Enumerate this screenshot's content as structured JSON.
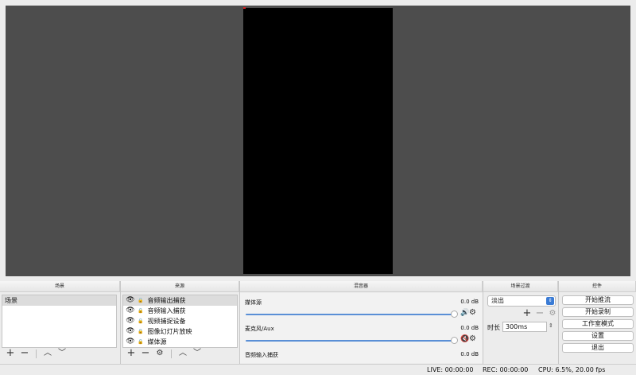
{
  "docks": {
    "scenes": {
      "title": "场景",
      "items": [
        {
          "label": "场景",
          "selected": true
        }
      ]
    },
    "sources": {
      "title": "来源",
      "items": [
        {
          "label": "音频输出捕获"
        },
        {
          "label": "音频输入捕获"
        },
        {
          "label": "视频捕捉设备"
        },
        {
          "label": "图像幻灯片放映"
        },
        {
          "label": "媒体源"
        }
      ]
    },
    "mixer": {
      "title": "混音器",
      "channels": [
        {
          "name": "媒体源",
          "db": "0.0 dB",
          "muted": false
        },
        {
          "name": "麦克风/Aux",
          "db": "0.0 dB",
          "muted": true
        },
        {
          "name": "音频输入捕获",
          "db": "0.0 dB",
          "muted": false
        }
      ]
    },
    "transitions": {
      "title": "场景过渡",
      "selected": "淡出",
      "duration_label": "时长",
      "duration_value": "300ms"
    },
    "controls": {
      "title": "控件",
      "buttons": [
        "开始推流",
        "开始录制",
        "工作室模式",
        "设置",
        "退出"
      ]
    }
  },
  "toolbar": {
    "add": "+",
    "remove": "−",
    "up": "︿",
    "down": "﹀",
    "gear": "⚙"
  },
  "status": {
    "live": "LIVE: 00:00:00",
    "rec": "REC: 00:00:00",
    "cpu": "CPU: 6.5%, 20.00 fps"
  },
  "colors": {
    "preview_bg": "#4d4d4d",
    "canvas": "#000000",
    "slider": "#5a8fd6",
    "mute": "#d32f2f"
  }
}
